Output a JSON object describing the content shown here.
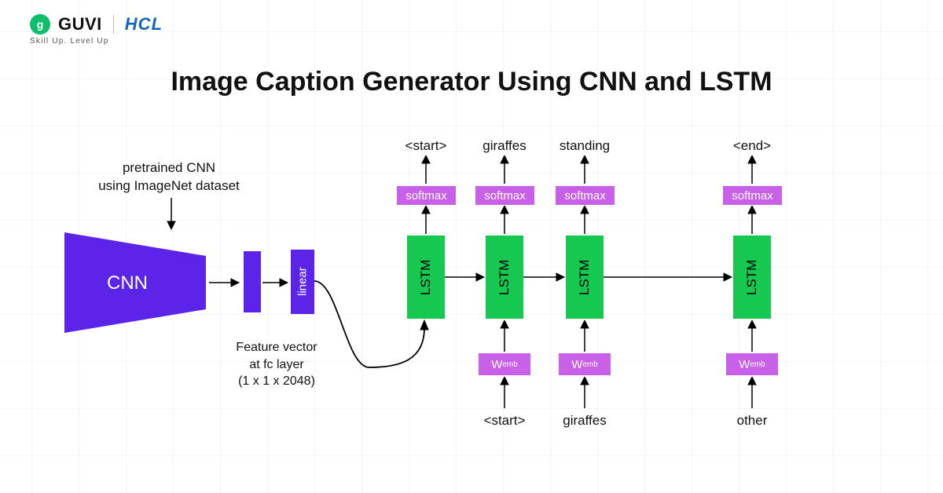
{
  "logo": {
    "guvi": "GUVI",
    "hcl": "HCL",
    "tagline": "Skill Up. Level Up"
  },
  "title": "Image Caption Generator Using CNN and LSTM",
  "labels": {
    "pretrained": "pretrained CNN\nusing ImageNet dataset",
    "cnn": "CNN",
    "linear": "linear",
    "feature_vector": "Feature vector\nat fc layer\n(1 x 1 x 2048)",
    "lstm": "LSTM",
    "softmax": "softmax",
    "wemb": "W",
    "wemb_sub": "emb",
    "out_start": "<start>",
    "out_giraffes": "giraffes",
    "out_standing": "standing",
    "out_end": "<end>",
    "in_start": "<start>",
    "in_giraffes": "giraffes",
    "in_other": "other"
  }
}
